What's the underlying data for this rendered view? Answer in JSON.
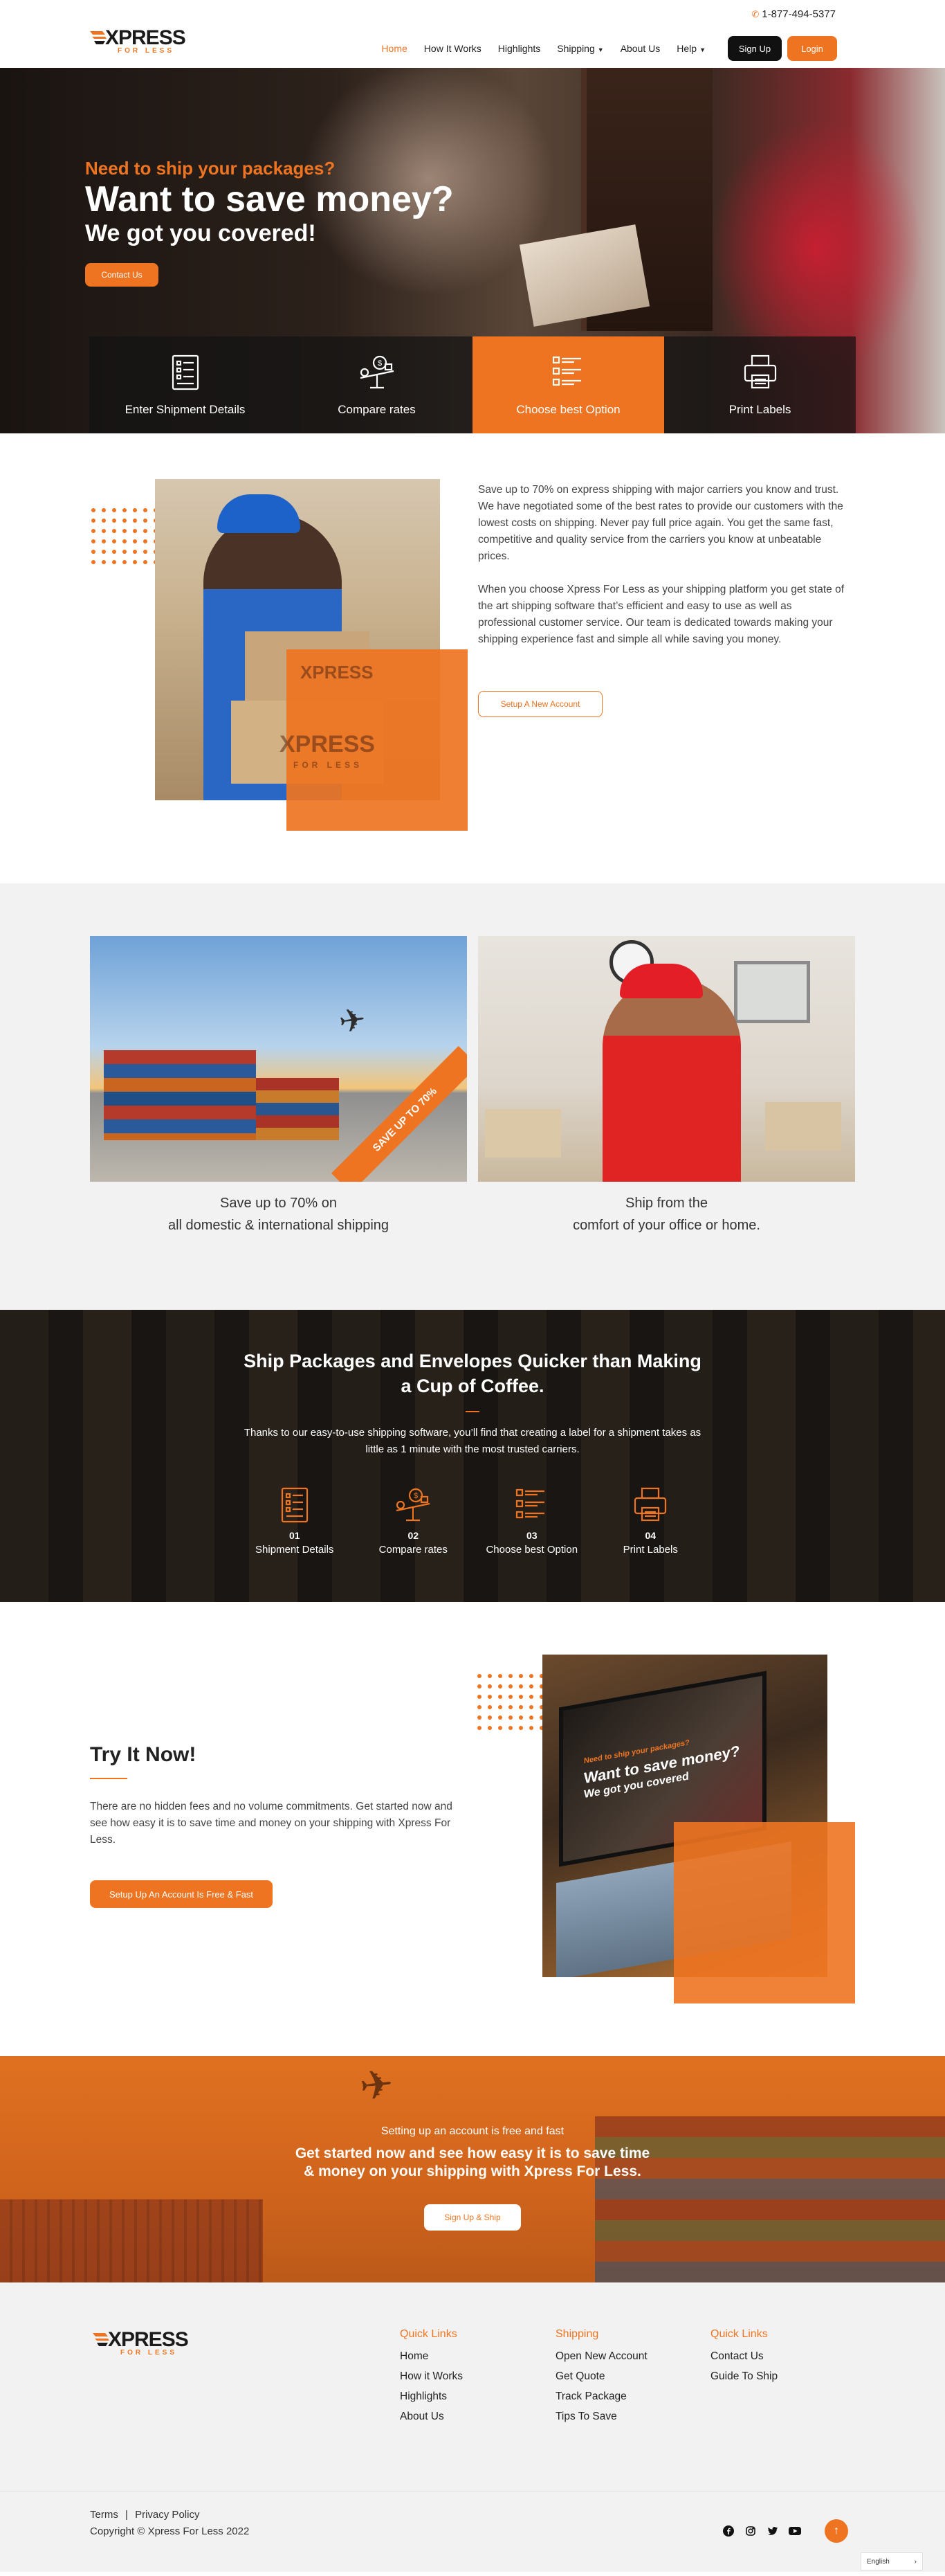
{
  "brand": {
    "name": "XPRESS",
    "tagline": "FOR LESS",
    "accent": "#ee7421"
  },
  "header": {
    "phone": "1-877-494-5377",
    "nav": [
      {
        "label": "Home",
        "active": true,
        "dropdown": false
      },
      {
        "label": "How It Works",
        "active": false,
        "dropdown": false
      },
      {
        "label": "Highlights",
        "active": false,
        "dropdown": false
      },
      {
        "label": "Shipping",
        "active": false,
        "dropdown": true
      },
      {
        "label": "About Us",
        "active": false,
        "dropdown": false
      },
      {
        "label": "Help",
        "active": false,
        "dropdown": true
      }
    ],
    "signup_label": "Sign Up",
    "login_label": "Login"
  },
  "hero": {
    "subtitle": "Need to ship your packages?",
    "title": "Want to save money?",
    "title2": "We got you covered!",
    "contact_label": "Contact Us",
    "steps": [
      {
        "label": "Enter Shipment Details",
        "icon": "shipment-form-icon",
        "active": false
      },
      {
        "label": "Compare rates",
        "icon": "scale-rates-icon",
        "active": false
      },
      {
        "label": "Choose best Option",
        "icon": "checklist-icon",
        "active": true
      },
      {
        "label": "Print Labels",
        "icon": "printer-icon",
        "active": false
      }
    ]
  },
  "about": {
    "para1": "Save up to 70% on express shipping with major carriers you know and trust. We have negotiated some of the best rates to provide our customers with the lowest costs on shipping. Never pay full price again. You get the same fast, competitive and quality service from the carriers you know at unbeatable prices.",
    "para2": "When you choose Xpress For Less as your shipping platform you get state of the art shipping software that’s efficient and easy to use as well as professional customer service. Our team is dedicated towards making your shipping experience fast and simple all while saving you money.",
    "button_label": "Setup A New Account",
    "photo_brand_name": "XPRESS",
    "photo_brand_tagline": "FOR LESS"
  },
  "features": {
    "ribbon": "SAVE UP TO 70%",
    "card1_line1": "Save up to 70% on",
    "card1_line2": "all domestic & international shipping",
    "card2_line1": "Ship from the",
    "card2_line2": "comfort of your office or home."
  },
  "warehouse": {
    "title_line1": "Ship Packages and Envelopes Quicker than Making",
    "title_line2": "a Cup of Coffee.",
    "desc": "Thanks to our easy-to-use shipping software, you’ll find that creating a label for a shipment takes as little as 1 minute with the most trusted carriers.",
    "steps": [
      {
        "num": "01",
        "label": "Shipment Details",
        "icon": "shipment-form-icon"
      },
      {
        "num": "02",
        "label": "Compare rates",
        "icon": "scale-rates-icon"
      },
      {
        "num": "03",
        "label": "Choose best Option",
        "icon": "checklist-icon"
      },
      {
        "num": "04",
        "label": "Print Labels",
        "icon": "printer-icon"
      }
    ]
  },
  "try": {
    "title": "Try It Now!",
    "text": "There are no hidden fees and no volume commitments. Get started now and see how easy it is to save time and money on your shipping with Xpress For Less.",
    "button_label": "Setup Up An Account Is Free & Fast",
    "screen_sub": "Need to ship your packages?",
    "screen_title": "Want to save money?",
    "screen_title2": "We got you covered"
  },
  "cta": {
    "small": "Setting up an account is free and fast",
    "big_line1": "Get started now and see how easy it is to save time",
    "big_line2": "& money on your shipping with Xpress For Less.",
    "button_label": "Sign Up & Ship"
  },
  "footer": {
    "col1": {
      "title": "Quick Links",
      "links": [
        "Home",
        "How it Works",
        "Highlights",
        "About Us"
      ]
    },
    "col2": {
      "title": "Shipping",
      "links": [
        "Open New Account",
        "Get Quote",
        "Track Package",
        "Tips To Save"
      ]
    },
    "col3": {
      "title": "Quick Links",
      "links": [
        "Contact Us",
        "Guide To Ship"
      ]
    }
  },
  "bottom": {
    "terms": "Terms",
    "separator": "|",
    "privacy": "Privacy Policy",
    "copyright": "Copyright © Xpress For Less 2022",
    "socials": [
      "facebook-icon",
      "instagram-icon",
      "twitter-icon",
      "youtube-icon"
    ],
    "language": "English"
  }
}
